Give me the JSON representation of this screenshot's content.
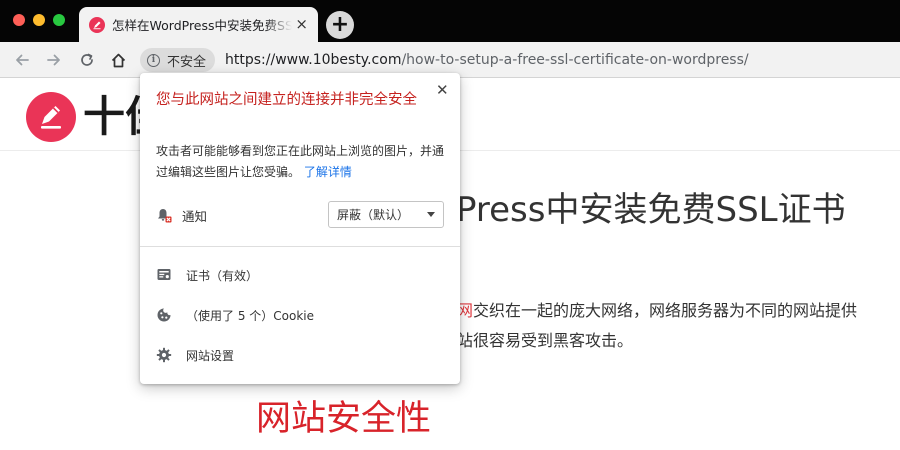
{
  "browser": {
    "tab": {
      "title": "怎样在WordPress中安装免费SSL证书",
      "close_symbol": "×"
    },
    "new_tab_symbol": "+",
    "omnibox": {
      "security_label": "不安全",
      "info_symbol": "i",
      "url_host": "https://www.10besty.com",
      "url_path": "/how-to-setup-a-free-ssl-certificate-on-wordpress/"
    },
    "colors": {
      "insecure_red": "#c5221f",
      "link_blue": "#1a73e8",
      "brand": "#ea3457"
    }
  },
  "page": {
    "site_name": "十佳",
    "article_title": "Press中安装免费SSL证书",
    "line1_highlight": "网",
    "line1_rest": "交织在一起的庞大网络，网络服务器为不同的网站提供",
    "line2": "站很容易受到黑客攻击。",
    "section_heading": "网站安全性"
  },
  "page_info_bubble": {
    "title": "您与此网站之间建立的连接并非完全安全",
    "close_symbol": "✕",
    "description": "攻击者可能能够看到您正在此网站上浏览的图片，并通过编辑这些图片让您受骗。",
    "learn_more": "了解详情",
    "permission": {
      "icon": "bell-blocked-icon",
      "label": "通知",
      "selected": "屏蔽（默认）"
    },
    "items": [
      {
        "icon": "certificate-icon",
        "label": "证书（有效）"
      },
      {
        "icon": "cookie-icon",
        "label": "（使用了 5 个）Cookie"
      },
      {
        "icon": "gear-icon",
        "label": "网站设置"
      }
    ]
  }
}
